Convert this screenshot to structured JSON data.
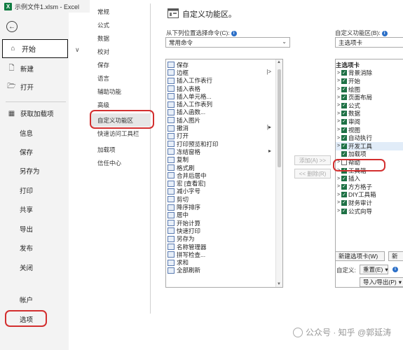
{
  "titlebar": {
    "title": "示例文件1.xlsm - Excel",
    "app_icon": "X"
  },
  "backstage": {
    "home": "开始",
    "items": [
      "新建",
      "打开",
      "获取加载项",
      "信息",
      "保存",
      "另存为",
      "打印",
      "共享",
      "导出",
      "发布",
      "关闭"
    ],
    "bottom": [
      "帐户",
      "选项"
    ],
    "tiny_glyph": "∨"
  },
  "options_nav": {
    "items": [
      "常规",
      "公式",
      "数据",
      "校对",
      "保存",
      "语言",
      "辅助功能",
      "高级",
      "自定义功能区",
      "快速访问工具栏",
      "加载项",
      "信任中心"
    ],
    "selected_index": 8
  },
  "customize": {
    "title": "自定义功能区。",
    "choose_label": "从下列位置选择命令(C):",
    "choose_value": "常用命令",
    "ribbon_label": "自定义功能区(B):",
    "ribbon_value": "主选项卡",
    "commands": [
      "保存",
      "边框",
      "插入工作表行",
      "插入表格",
      "插入单元格...",
      "插入工作表列",
      "插入函数...",
      "插入图片",
      "撤消",
      "打开",
      "打印预览和打印",
      "冻结窗格",
      "复制",
      "格式刷",
      "合并后居中",
      "宏 [查看宏]",
      "减小字号",
      "剪切",
      "降序排序",
      "居中",
      "开始计算",
      "快速打印",
      "另存为",
      "名称管理器",
      "拼写检查...",
      "求和",
      "全部刷新"
    ],
    "add_button": "添加(A) >>",
    "remove_button": "<< 删除(R)",
    "tree_header": "主选项卡",
    "tabs": [
      {
        "label": "背景消除",
        "checked": true
      },
      {
        "label": "开始",
        "checked": true
      },
      {
        "label": "绘图",
        "checked": true
      },
      {
        "label": "页面布局",
        "checked": true
      },
      {
        "label": "公式",
        "checked": true
      },
      {
        "label": "数据",
        "checked": true
      },
      {
        "label": "审阅",
        "checked": true
      },
      {
        "label": "视图",
        "checked": true
      },
      {
        "label": "自动执行",
        "checked": true
      },
      {
        "label": "开发工具",
        "checked": true
      },
      {
        "label": "加载项",
        "checked": true
      },
      {
        "label": "帮助",
        "checked": false
      },
      {
        "label": "工具箱",
        "checked": true
      },
      {
        "label": "插入",
        "checked": true
      },
      {
        "label": "方方格子",
        "checked": true
      },
      {
        "label": "DIY工具箱",
        "checked": true
      },
      {
        "label": "财务审计",
        "checked": true
      },
      {
        "label": "公式向导",
        "checked": true
      }
    ],
    "new_tab_button": "新建选项卡(W)",
    "new_group_button": "新",
    "custom_label": "自定义:",
    "reset_button": "重置(E)",
    "import_export_button": "导入/导出(P)"
  },
  "watermark": "公众号 · 知乎 @郭延涛"
}
